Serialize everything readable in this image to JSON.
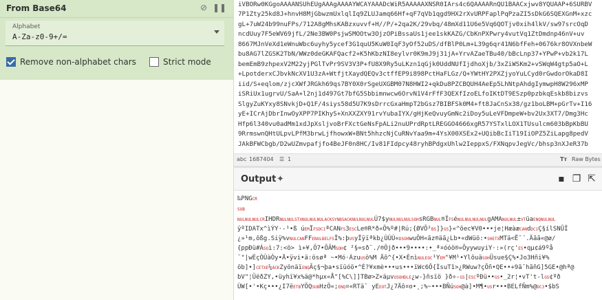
{
  "operation": {
    "title": "From Base64",
    "alphabet_label": "Alphabet",
    "alphabet_value": "A-Za-z0-9+/=",
    "remove_non_alpha_label": "Remove non-alphabet chars",
    "remove_non_alpha_checked": true,
    "strict_mode_label": "Strict mode",
    "strict_mode_checked": false
  },
  "input": {
    "lines": [
      "iVBORw0KGgoAAAANSUhEUgAAAgAAAAYWCAYAAADcWiR5AAAAAXNSR0IArs4c6QAAAARnQU1BAACxjwv8YQUAAP+6SURBV",
      "7P1Zty25kd8J+hnvH8MjGbwzmUxlqlIq9ZLUJamq66Hf+qF7qVb1qgd9HX2rXvURPFaplPqPzaZI5sDkG6SQEXGnM+xzc",
      "gL+7uW24b99nuFPs/712A8gMhsKABzxuvvf+H//P/+2qa2K/29vbq/48mXd11U6e5Vq6QOTjv0xih4lkV/sw97srcOqD",
      "ncdUuy7F5eWV69jfL/2Ne3BW0PsjwSMOOtw3OjzOPiBssaUs1jee1skKAZG/CbKnPXPwry4vutVq1ZtDmdnp46nV+uv",
      "8667MJnVeXd1eWnuWbc6uyhy5ycef3G1quU5KuW0IqF3yOf52uDS/dfBlP0Lm+L39g6qr41N6bfFeh+0676kr8OVXnbeW",
      "bu8AG7lZGSK2TbN/WWz0deGKAFQacf2+K5hKbzNI8eylvr0K9mJ9j31jA+YrvAZaeTBu40/bBcLnp37+YPwP+vb2k17L",
      "bemEmB9zhpexV2M22yjPGlTvPr9SV3V3P+fU8X9Ry5uLKzn1qGjk0UddNUfIjdhoXjb/3xZiWSKm2+vSWqW4gtp5aO+L",
      "+LpotderxCJbvkNcXV1U3zA+WtfjtXaydQEQv3ctffEP9i898PctHaFLGz/Q+YWtHY2PXZjyoYuLCyd0rGwdorOkaD8I",
      "iid/S+eqlom/zjcXWfJRGkh69qs7BY0X0rSgeUXGBM07N8HWI2+qkDu8PZCBQUH4AeEp5LhNtpAhdgIymwpH8W296xMP",
      "iSRiUx1ugrvU/SaA+l2nj1d497Gt7bfG5Sbbimnwcw6OrvN1V4rFfF3QEXfIzoELfoIKtDT9ESzp0pzbkqEskb8bizvs",
      "SlgyZuKYxy8SNvkjD+Q1F/4siys58d5U7K9sDrrcGxaHmpT2bGsz7BIBFSk0M4+ft8JaCnSx38/gz1boLBM+pGrTv+I16",
      "yE+ICrAjDbrInwOyXPP7PIKhyS+XnXXZXY91rvYubaIYX/gHjKeQvuyGmNc2iDoy5uLeVFDmpeW+bv2Ux3XT7/Dmg3Hc",
      "Hfp6l340vu0adMm1xdJpXsljvoBrFXctGeNsFpALi2nuUPrdRptLREGGO4666xgR57YSTxlLOX1TUsulcm603bBpKbBU",
      "9RrmswnQHtULpvLPfM3brwLjfhowxW+BNt5hhzcNjCuRNvYaa9m+4YsX00XSEx2+UQibBcIiT19IiOPZ5ZiLapg8pedV",
      "JAkBFWCbgb/D2wUZmvpafjfo4BeJF0n8HC/Iv81FIdpcy48ryhBPdgxUhlw2IeppxS/FXNqpvJegVc/bhsp3nXJeR37b"
    ],
    "char_count": "1687404",
    "line_count": "1",
    "raw_bytes_label": "Raw Bytes"
  },
  "output": {
    "title": "Output",
    "lines": [
      [
        {
          "t": "‰PNG",
          "r": false
        },
        {
          "t": "CR",
          "r": true
        }
      ],
      [
        {
          "t": "SUB",
          "r": true
        }
      ],
      [
        {
          "t": "NULNULNULCR",
          "r": true
        },
        {
          "t": "IHDR",
          "r": false
        },
        {
          "t": "NULNULSTXNULNULNULACKSYNBSACKNULNULNUL",
          "r": true
        },
        {
          "t": "Ú7$y",
          "r": false
        },
        {
          "t": "NULNULNULSOH",
          "r": true
        },
        {
          "t": "sRGB",
          "r": false
        },
        {
          "t": "NUL",
          "r": true
        },
        {
          "t": "®Î",
          "r": false
        },
        {
          "t": "FS",
          "r": true
        },
        {
          "t": "é",
          "r": false
        },
        {
          "t": "NULNULNULNUL",
          "r": true
        },
        {
          "t": "gAMA",
          "r": false
        },
        {
          "t": "NULNUL",
          "r": true
        },
        {
          "t": "±",
          "r": false
        },
        {
          "t": "VT",
          "r": true
        },
        {
          "t": "üa",
          "r": false
        },
        {
          "t": "ENQNULNUL",
          "r": true
        }
      ],
      [
        {
          "t": "ÿºIDATx^ìÝY·-¹•ß    ú",
          "r": false
        },
        {
          "t": "EM",
          "r": true
        },
        {
          "t": "Ï",
          "r": false
        },
        {
          "t": "FS",
          "r": true
        },
        {
          "t": "DC1",
          "r": true
        },
        {
          "t": "ªCAN",
          "r": false
        },
        {
          "t": "FS",
          "r": true
        },
        {
          "t": "3",
          "r": false
        },
        {
          "t": "ESC",
          "r": true
        },
        {
          "t": "Le®R*ð«Ö%º#|Rú;{ØVÕ²",
          "r": false
        },
        {
          "t": "BS",
          "r": true
        },
        {
          "t": "]}",
          "r": false
        },
        {
          "t": "GS",
          "r": true
        },
        {
          "t": "}«^õec¥V0•••je¦Hæàæ",
          "r": false
        },
        {
          "t": "CAN",
          "r": true
        },
        {
          "t": "d",
          "r": false
        },
        {
          "t": "DC1",
          "r": true
        },
        {
          "t": "Ç§ílSNÛÎ",
          "r": false
        }
      ],
      [
        {
          "t": "¿»¹m,ôßg.Siÿ%v",
          "r": false
        },
        {
          "t": "NULCAN",
          "r": true
        },
        {
          "t": "FF",
          "r": false
        },
        {
          "t": "ENULBEL",
          "r": true
        },
        {
          "t": "FS",
          "r": true
        },
        {
          "t": "Ï%:þ",
          "r": false
        },
        {
          "t": "US",
          "r": true
        },
        {
          "t": "yÏÿïªkb¿ÙÙÙ«",
          "r": false
        },
        {
          "t": "DSOH",
          "r": true
        },
        {
          "t": "wuÕH«ãz®äã¿Lb•«dWüö:•",
          "r": false
        },
        {
          "t": "SHETX",
          "r": true
        },
        {
          "t": "MTä<Ë¯´.Äãã«@ø/",
          "r": false
        }
      ],
      [
        {
          "t": "{ppÐü#Á",
          "r": false
        },
        {
          "t": "SO",
          "r": true
        },
        {
          "t": "ì:7:<ö> ì+¥,Ö7•ÕÃM",
          "r": false
        },
        {
          "t": "SOH",
          "r": true
        },
        {
          "t": "¢     ²§=sð¨./®Öjð•••9••••:•_ª¤óóö®»ÕyywuyiY·:»(rç'",
          "r": false
        },
        {
          "t": "ES",
          "r": true
        },
        {
          "t": "•qµ¢á9ºå",
          "r": false
        }
      ],
      [
        {
          "t": "¨\"|wÈçÒÙàÒy•Ä•ÿvi•ä:ösøª ~•Mó·Àzu",
          "r": false
        },
        {
          "t": "US",
          "r": true
        },
        {
          "t": "ö%M Äõ^{•X•Ènì",
          "r": false
        },
        {
          "t": "NULEOC",
          "r": true
        },
        {
          "t": "¹Y",
          "r": false
        },
        {
          "t": "EM",
          "r": true
        },
        {
          "t": "\"¥M¹•Ylôuä",
          "r": false
        },
        {
          "t": "SOH",
          "r": true
        },
        {
          "t": "Üsue§Ç%•Jo3Hñi¥%",
          "r": false
        }
      ],
      [
        {
          "t": "öb]•]",
          "r": false
        },
        {
          "t": "CETXE",
          "r": true
        },
        {
          "t": "¼",
          "r": false
        },
        {
          "t": "ACK",
          "r": true
        },
        {
          "t": "Zyönäï",
          "r": false
        },
        {
          "t": "ENQ",
          "r": true
        },
        {
          "t": "Ãç§¬þa•sïüóö•^É?¥xmè•••us•••ïWc6Ô{ÌsuTî>¿RWuw?çÕñ•QE••+9ã¯hãñG]5GE•@hª@",
          "r": false
        }
      ],
      [
        {
          "t": "bV\"¦ÜëðZY,•üyhï¥x%ä@*hµx«Å\"[%C\\]]TBø>Z×äµv",
          "r": false
        },
        {
          "t": "USOHDLE",
          "r": true
        },
        {
          "t": "¿w-}ñsïö }ð÷-",
          "r": false
        },
        {
          "t": "GS",
          "r": true
        },
        {
          "t": "|",
          "r": false
        },
        {
          "t": "ESC",
          "r": true
        },
        {
          "t": "ºÐü••",
          "r": false
        },
        {
          "t": "GS",
          "r": true
        },
        {
          "t": "•_2r¦•vT't-l",
          "r": false
        },
        {
          "t": "GS",
          "r": true
        },
        {
          "t": "¢ºð",
          "r": false
        }
      ],
      [
        {
          "t": "ÙW[•'•Kç•••¿I7ë",
          "r": false
        },
        {
          "t": "ETB",
          "r": true
        },
        {
          "t": "YÕQ",
          "r": false
        },
        {
          "t": "SUB",
          "r": true
        },
        {
          "t": "HzÖ«;",
          "r": false
        },
        {
          "t": "ENQ",
          "r": true
        },
        {
          "t": "¤«RTä¯ yE",
          "r": false
        },
        {
          "t": "EOT",
          "r": true
        },
        {
          "t": "J¿7Äô¤o•¸;%~•••BÑú",
          "r": false
        },
        {
          "t": "SOH",
          "r": true
        },
        {
          "t": "@à]•M¶•",
          "r": false
        },
        {
          "t": "US",
          "r": true
        },
        {
          "t": "r•••BELfÑm%@",
          "r": false
        },
        {
          "t": "DC3",
          "r": true
        },
        {
          "t": "•$bS",
          "r": false
        }
      ]
    ]
  }
}
